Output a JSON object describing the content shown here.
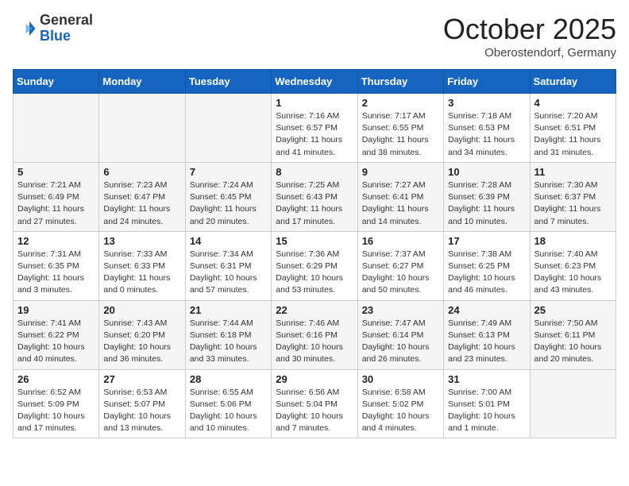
{
  "header": {
    "logo_general": "General",
    "logo_blue": "Blue",
    "month_title": "October 2025",
    "location": "Oberostendorf, Germany"
  },
  "weekdays": [
    "Sunday",
    "Monday",
    "Tuesday",
    "Wednesday",
    "Thursday",
    "Friday",
    "Saturday"
  ],
  "weeks": [
    [
      {
        "day": "",
        "info": ""
      },
      {
        "day": "",
        "info": ""
      },
      {
        "day": "",
        "info": ""
      },
      {
        "day": "1",
        "info": "Sunrise: 7:16 AM\nSunset: 6:57 PM\nDaylight: 11 hours and 41 minutes."
      },
      {
        "day": "2",
        "info": "Sunrise: 7:17 AM\nSunset: 6:55 PM\nDaylight: 11 hours and 38 minutes."
      },
      {
        "day": "3",
        "info": "Sunrise: 7:18 AM\nSunset: 6:53 PM\nDaylight: 11 hours and 34 minutes."
      },
      {
        "day": "4",
        "info": "Sunrise: 7:20 AM\nSunset: 6:51 PM\nDaylight: 11 hours and 31 minutes."
      }
    ],
    [
      {
        "day": "5",
        "info": "Sunrise: 7:21 AM\nSunset: 6:49 PM\nDaylight: 11 hours and 27 minutes."
      },
      {
        "day": "6",
        "info": "Sunrise: 7:23 AM\nSunset: 6:47 PM\nDaylight: 11 hours and 24 minutes."
      },
      {
        "day": "7",
        "info": "Sunrise: 7:24 AM\nSunset: 6:45 PM\nDaylight: 11 hours and 20 minutes."
      },
      {
        "day": "8",
        "info": "Sunrise: 7:25 AM\nSunset: 6:43 PM\nDaylight: 11 hours and 17 minutes."
      },
      {
        "day": "9",
        "info": "Sunrise: 7:27 AM\nSunset: 6:41 PM\nDaylight: 11 hours and 14 minutes."
      },
      {
        "day": "10",
        "info": "Sunrise: 7:28 AM\nSunset: 6:39 PM\nDaylight: 11 hours and 10 minutes."
      },
      {
        "day": "11",
        "info": "Sunrise: 7:30 AM\nSunset: 6:37 PM\nDaylight: 11 hours and 7 minutes."
      }
    ],
    [
      {
        "day": "12",
        "info": "Sunrise: 7:31 AM\nSunset: 6:35 PM\nDaylight: 11 hours and 3 minutes."
      },
      {
        "day": "13",
        "info": "Sunrise: 7:33 AM\nSunset: 6:33 PM\nDaylight: 11 hours and 0 minutes."
      },
      {
        "day": "14",
        "info": "Sunrise: 7:34 AM\nSunset: 6:31 PM\nDaylight: 10 hours and 57 minutes."
      },
      {
        "day": "15",
        "info": "Sunrise: 7:36 AM\nSunset: 6:29 PM\nDaylight: 10 hours and 53 minutes."
      },
      {
        "day": "16",
        "info": "Sunrise: 7:37 AM\nSunset: 6:27 PM\nDaylight: 10 hours and 50 minutes."
      },
      {
        "day": "17",
        "info": "Sunrise: 7:38 AM\nSunset: 6:25 PM\nDaylight: 10 hours and 46 minutes."
      },
      {
        "day": "18",
        "info": "Sunrise: 7:40 AM\nSunset: 6:23 PM\nDaylight: 10 hours and 43 minutes."
      }
    ],
    [
      {
        "day": "19",
        "info": "Sunrise: 7:41 AM\nSunset: 6:22 PM\nDaylight: 10 hours and 40 minutes."
      },
      {
        "day": "20",
        "info": "Sunrise: 7:43 AM\nSunset: 6:20 PM\nDaylight: 10 hours and 36 minutes."
      },
      {
        "day": "21",
        "info": "Sunrise: 7:44 AM\nSunset: 6:18 PM\nDaylight: 10 hours and 33 minutes."
      },
      {
        "day": "22",
        "info": "Sunrise: 7:46 AM\nSunset: 6:16 PM\nDaylight: 10 hours and 30 minutes."
      },
      {
        "day": "23",
        "info": "Sunrise: 7:47 AM\nSunset: 6:14 PM\nDaylight: 10 hours and 26 minutes."
      },
      {
        "day": "24",
        "info": "Sunrise: 7:49 AM\nSunset: 6:13 PM\nDaylight: 10 hours and 23 minutes."
      },
      {
        "day": "25",
        "info": "Sunrise: 7:50 AM\nSunset: 6:11 PM\nDaylight: 10 hours and 20 minutes."
      }
    ],
    [
      {
        "day": "26",
        "info": "Sunrise: 6:52 AM\nSunset: 5:09 PM\nDaylight: 10 hours and 17 minutes."
      },
      {
        "day": "27",
        "info": "Sunrise: 6:53 AM\nSunset: 5:07 PM\nDaylight: 10 hours and 13 minutes."
      },
      {
        "day": "28",
        "info": "Sunrise: 6:55 AM\nSunset: 5:06 PM\nDaylight: 10 hours and 10 minutes."
      },
      {
        "day": "29",
        "info": "Sunrise: 6:56 AM\nSunset: 5:04 PM\nDaylight: 10 hours and 7 minutes."
      },
      {
        "day": "30",
        "info": "Sunrise: 6:58 AM\nSunset: 5:02 PM\nDaylight: 10 hours and 4 minutes."
      },
      {
        "day": "31",
        "info": "Sunrise: 7:00 AM\nSunset: 5:01 PM\nDaylight: 10 hours and 1 minute."
      },
      {
        "day": "",
        "info": ""
      }
    ]
  ]
}
